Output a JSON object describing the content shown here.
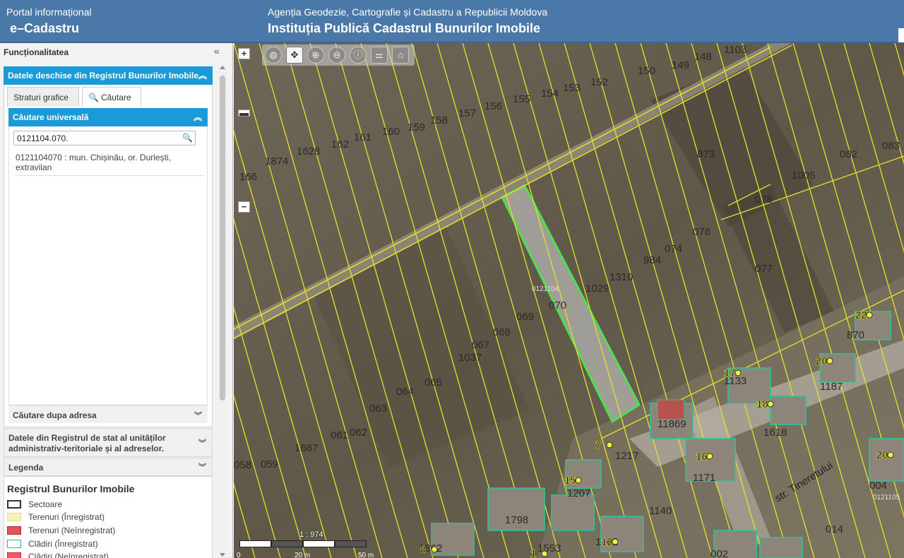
{
  "header": {
    "portal_small": "Portal informațional",
    "portal_big": "e–Cadastru",
    "agency_small": "Agenția Geodezie, Cartografie și Cadastru a Republicii Moldova",
    "agency_big": "Instituția Publică Cadastrul Bunurilor Imobile"
  },
  "sidebar": {
    "title": "Funcționalitatea",
    "collapse_icon": "double-chevron-left-icon",
    "open_data_header": "Datele deschise din Registrul Bunurilor Imobile",
    "tabs": [
      {
        "label": "Straturi grafice",
        "active": false
      },
      {
        "label": "Căutare",
        "active": true,
        "icon": "search-icon"
      }
    ],
    "universal_search_header": "Căutare universală",
    "search_value": "0121104.070.",
    "result_text": "0121104070 : mun. Chișinău, or. Durlești, extravilan",
    "address_search_header": "Căutare dupa adresa",
    "state_register_header": "Datele din Registrul de stat al unităților administrativ-teritoriale și al adreselor.",
    "legend_header": "Legenda",
    "legend": {
      "title": "Registrul Bunurilor Imobile",
      "items": [
        {
          "label": "Sectoare",
          "color": "#ffffff",
          "border": "#333333"
        },
        {
          "label": "Terenuri (Înregistrat)",
          "color": "#f6f3b6",
          "border": "#e8e080"
        },
        {
          "label": "Terenuri (Neînregistrat)",
          "color": "#e05555",
          "border": "#b03030"
        },
        {
          "label": "Clădiri (Înregistrat)",
          "color": "#ffffff",
          "border": "#2eb89a"
        },
        {
          "label": "Clădiri (Neînregistrat)",
          "color": "#f05a64",
          "border": "#c03040"
        }
      ]
    }
  },
  "map": {
    "zoom_in": "+",
    "zoom_out": "−",
    "tools": [
      "globe-icon",
      "pan-icon",
      "zoom-in-icon",
      "zoom-out-icon",
      "info-icon",
      "measure-icon",
      "building-icon"
    ],
    "scale_text": "1 : 974",
    "scale_labels": [
      "0",
      "20 m",
      "50 m"
    ],
    "street": "str. Tineretului",
    "parcel_labels": [
      "1103",
      "148",
      "149",
      "150",
      "152",
      "153",
      "154",
      "155",
      "156",
      "157",
      "158",
      "159",
      "160",
      "161",
      "162",
      "1628",
      "1874",
      "166",
      "082",
      "083",
      "873",
      "1005",
      "078",
      "076",
      "074",
      "077",
      "984",
      "1310",
      "1029",
      "070",
      "0121104",
      "069",
      "068",
      "067",
      "1037",
      "065",
      "064",
      "063",
      "062",
      "061",
      "1687",
      "059",
      "058",
      "870",
      "1187",
      "1133",
      "1618",
      "11869",
      "1217",
      "1171",
      "1207",
      "1140",
      "1798",
      "1553",
      "1862",
      "002",
      "014",
      "004",
      "0121105",
      "1182"
    ],
    "building_numbers": [
      "22",
      "20",
      "17",
      "18",
      "7",
      "16",
      "15",
      "20",
      "12",
      "8",
      "1"
    ]
  }
}
